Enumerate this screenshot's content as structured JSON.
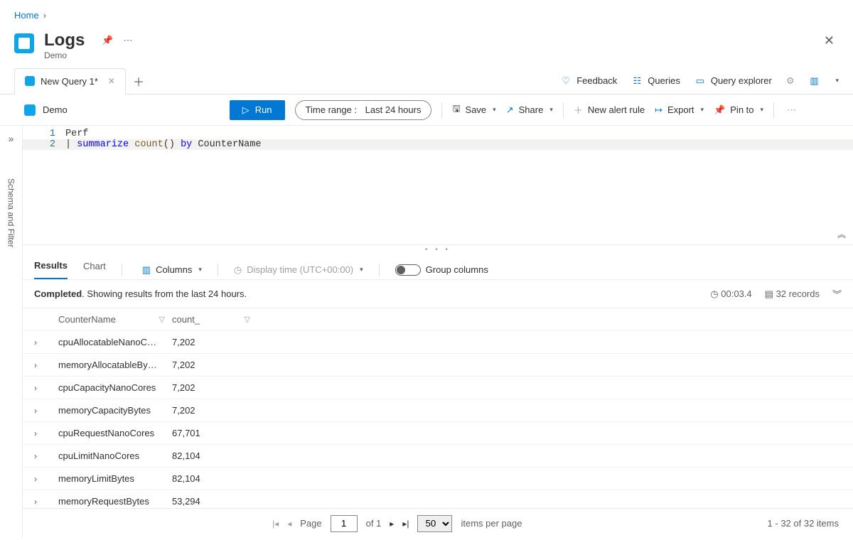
{
  "breadcrumb": {
    "home": "Home"
  },
  "header": {
    "title": "Logs",
    "subtitle": "Demo"
  },
  "tab": {
    "label": "New Query 1*"
  },
  "topbar": {
    "feedback": "Feedback",
    "queries": "Queries",
    "query_explorer": "Query explorer"
  },
  "toolbar": {
    "scope": "Demo",
    "run": "Run",
    "time_label": "Time range :",
    "time_value": "Last 24 hours",
    "save": "Save",
    "share": "Share",
    "new_alert": "New alert rule",
    "export": "Export",
    "pin": "Pin to"
  },
  "rail": {
    "expand_title": "Expand",
    "label": "Schema and Filter"
  },
  "editor": {
    "lines": [
      {
        "n": "1",
        "raw": "Perf"
      },
      {
        "n": "2",
        "raw": "| summarize count() by CounterName"
      }
    ]
  },
  "results_tabs": {
    "results": "Results",
    "chart": "Chart",
    "columns": "Columns",
    "display_time": "Display time (UTC+00:00)",
    "group_columns": "Group columns"
  },
  "status": {
    "completed": "Completed",
    "detail": ". Showing results from the last 24 hours.",
    "elapsed": "00:03.4",
    "records": "32 records"
  },
  "grid": {
    "col1": "CounterName",
    "col2": "count_",
    "rows": [
      {
        "name": "cpuAllocatableNanoC…",
        "count": "7,202"
      },
      {
        "name": "memoryAllocatableBy…",
        "count": "7,202"
      },
      {
        "name": "cpuCapacityNanoCores",
        "count": "7,202"
      },
      {
        "name": "memoryCapacityBytes",
        "count": "7,202"
      },
      {
        "name": "cpuRequestNanoCores",
        "count": "67,701"
      },
      {
        "name": "cpuLimitNanoCores",
        "count": "82,104"
      },
      {
        "name": "memoryLimitBytes",
        "count": "82,104"
      },
      {
        "name": "memoryRequestBytes",
        "count": "53,294"
      }
    ]
  },
  "pager": {
    "page_label": "Page",
    "page_value": "1",
    "of_label": "of 1",
    "page_size": "50",
    "per_page": "items per page",
    "summary": "1 - 32 of 32 items"
  }
}
